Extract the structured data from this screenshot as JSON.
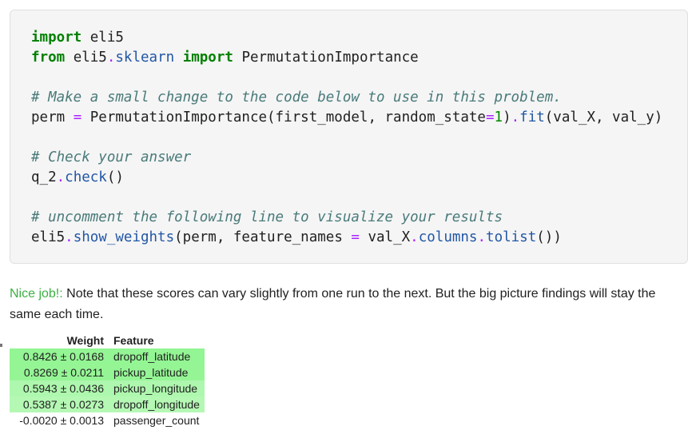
{
  "code_cell": {
    "lines": [
      [
        {
          "t": "import",
          "c": "kw"
        },
        {
          "t": " eli5",
          "c": ""
        }
      ],
      [
        {
          "t": "from",
          "c": "kw"
        },
        {
          "t": " eli5",
          "c": ""
        },
        {
          "t": ".",
          "c": "op"
        },
        {
          "t": "sklearn",
          "c": "attr"
        },
        {
          "t": " ",
          "c": ""
        },
        {
          "t": "import",
          "c": "kw"
        },
        {
          "t": " PermutationImportance",
          "c": ""
        }
      ],
      [],
      [
        {
          "t": "# Make a small change to the code below to use in this problem.",
          "c": "cm"
        }
      ],
      [
        {
          "t": "perm ",
          "c": ""
        },
        {
          "t": "=",
          "c": "op"
        },
        {
          "t": " PermutationImportance(first_model, random_state",
          "c": ""
        },
        {
          "t": "=",
          "c": "op"
        },
        {
          "t": "1",
          "c": "num"
        },
        {
          "t": ")",
          "c": ""
        },
        {
          "t": ".",
          "c": "op"
        },
        {
          "t": "fit",
          "c": "attr"
        },
        {
          "t": "(val_X, val_y)",
          "c": ""
        }
      ],
      [],
      [
        {
          "t": "# Check your answer",
          "c": "cm"
        }
      ],
      [
        {
          "t": "q_2",
          "c": ""
        },
        {
          "t": ".",
          "c": "op"
        },
        {
          "t": "check",
          "c": "attr"
        },
        {
          "t": "()",
          "c": ""
        }
      ],
      [],
      [
        {
          "t": "# uncomment the following line to visualize your results",
          "c": "cm"
        }
      ],
      [
        {
          "t": "eli5",
          "c": ""
        },
        {
          "t": ".",
          "c": "op"
        },
        {
          "t": "show_weights",
          "c": "attr"
        },
        {
          "t": "(perm, feature_names ",
          "c": ""
        },
        {
          "t": "=",
          "c": "op"
        },
        {
          "t": " val_X",
          "c": ""
        },
        {
          "t": ".",
          "c": "op"
        },
        {
          "t": "columns",
          "c": "attr"
        },
        {
          "t": ".",
          "c": "op"
        },
        {
          "t": "tolist",
          "c": "attr"
        },
        {
          "t": "())",
          "c": ""
        }
      ]
    ]
  },
  "output": {
    "success_label": "Nice job!:",
    "message": " Note that these scores can vary slightly from one run to the next. But the big picture findings will stay the same each time."
  },
  "weights_table": {
    "headers": {
      "weight": "Weight",
      "feature": "Feature"
    },
    "rows": [
      {
        "weight": "0.8426 ± 0.0168",
        "feature": "dropoff_latitude",
        "color": "#93f593"
      },
      {
        "weight": "0.8269 ± 0.0211",
        "feature": "pickup_latitude",
        "color": "#95f595"
      },
      {
        "weight": "0.5943 ± 0.0436",
        "feature": "pickup_longitude",
        "color": "#aef7ae"
      },
      {
        "weight": "0.5387 ± 0.0273",
        "feature": "dropoff_longitude",
        "color": "#b4f8b4"
      },
      {
        "weight": "-0.0020 ± 0.0013",
        "feature": "passenger_count",
        "color": "#ffffff"
      }
    ]
  }
}
